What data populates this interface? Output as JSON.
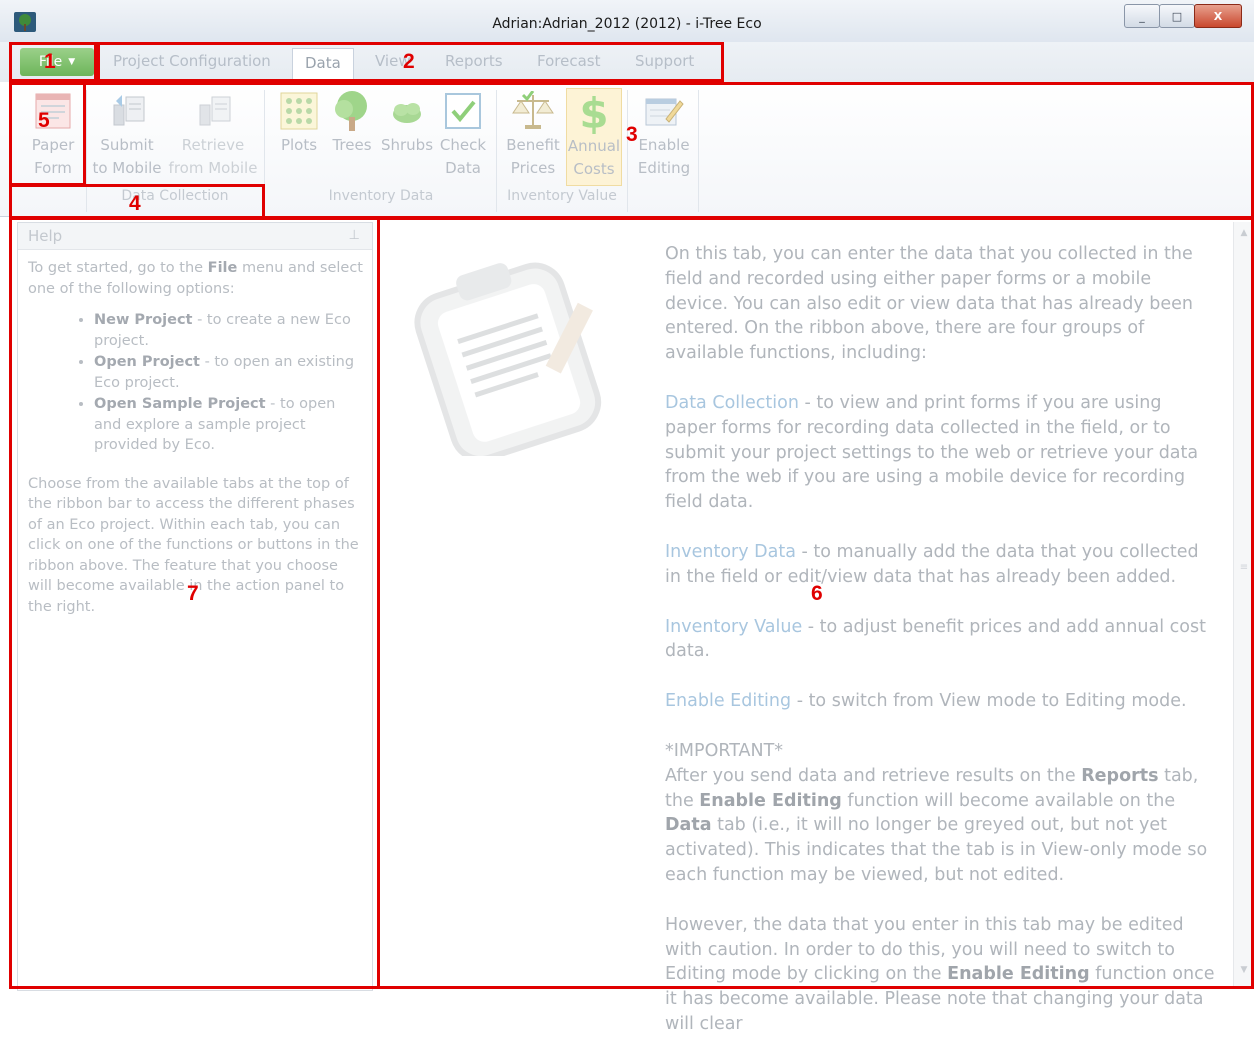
{
  "window": {
    "title": "Adrian:Adrian_2012 (2012) - i-Tree Eco",
    "controls": [
      "_",
      "□",
      "X"
    ]
  },
  "menu": {
    "file_label": "File",
    "tabs": [
      "Project Configuration",
      "Data",
      "View",
      "Reports",
      "Forecast",
      "Support"
    ],
    "active_tab": "Data"
  },
  "ribbon": {
    "buttons": [
      {
        "line1": "Paper",
        "line2": "Form",
        "icon": "paper-form-icon"
      },
      {
        "line1": "Submit",
        "line2": "to Mobile",
        "icon": "submit-mobile-icon"
      },
      {
        "line1": "Retrieve",
        "line2": "from Mobile",
        "icon": "retrieve-mobile-icon"
      },
      {
        "line1": "Plots",
        "line2": "",
        "icon": "plots-icon"
      },
      {
        "line1": "Trees",
        "line2": "",
        "icon": "tree-icon"
      },
      {
        "line1": "Shrubs",
        "line2": "",
        "icon": "shrub-icon"
      },
      {
        "line1": "Check",
        "line2": "Data",
        "icon": "check-icon"
      },
      {
        "line1": "Benefit",
        "line2": "Prices",
        "icon": "scales-icon"
      },
      {
        "line1": "Annual",
        "line2": "Costs",
        "icon": "dollar-icon"
      },
      {
        "line1": "Enable",
        "line2": "Editing",
        "icon": "edit-icon"
      }
    ],
    "groups": [
      "Data Collection",
      "Inventory Data",
      "Inventory Value"
    ]
  },
  "help": {
    "title": "Help",
    "intro_prefix": "To get started, go to the ",
    "intro_bold": "File",
    "intro_suffix": " menu and select one of the following options:",
    "items": [
      {
        "bold": "New Project",
        "text": " - to create a new Eco project."
      },
      {
        "bold": "Open Project",
        "text": " - to open an existing Eco project."
      },
      {
        "bold": "Open Sample Project",
        "text": " - to open and explore a sample project provided by Eco."
      }
    ],
    "outro": "Choose from the available tabs at the top of the ribbon bar to access the different phases of an Eco project. Within each tab, you can click on one of the functions or buttons in the ribbon above. The feature that you choose will become available in the action panel to the right."
  },
  "content": {
    "intro": "On this tab, you can enter the data that you collected in the field and recorded using either paper forms or a mobile device. You can also edit or view data that has already been entered. On the ribbon above, there are four groups of available functions, including:",
    "sections": [
      {
        "link": "Data Collection",
        "text": " - to view and print forms if you are using paper forms for recording data collected in the field, or to submit your project settings to the web or retrieve your data from the web if you are using a mobile device for recording field data."
      },
      {
        "link": "Inventory Data",
        "text": " - to manually add the data that you collected in the field or edit/view data that has already been added."
      },
      {
        "link": "Inventory Value",
        "text": " - to adjust benefit prices and add annual cost data."
      },
      {
        "link": "Enable Editing",
        "text": " - to switch from View mode to Editing mode."
      }
    ],
    "important_title": "*IMPORTANT*",
    "important_a": "After you send data and retrieve results on the ",
    "important_b1": "Reports",
    "important_c": " tab, the ",
    "important_b2": "Enable Editing",
    "important_d": " function will become available on the ",
    "important_b3": "Data",
    "important_e": " tab (i.e., it will no longer be greyed out, but not yet activated). This indicates that the tab is in View-only mode so each function may be viewed, but not edited.",
    "caution_a": "However, the data that you enter in this tab may be edited with caution. In order to do this, you will need to switch to Editing mode by clicking on the ",
    "caution_b": "Enable Editing",
    "caution_c": " function once it has become available. Please note that changing your data will clear"
  },
  "annotations": [
    "1",
    "2",
    "3",
    "4",
    "5",
    "6",
    "7"
  ],
  "colors": {
    "annotation": "#e00000",
    "file_button": "#7fc06b",
    "link": "#a8c6df"
  }
}
